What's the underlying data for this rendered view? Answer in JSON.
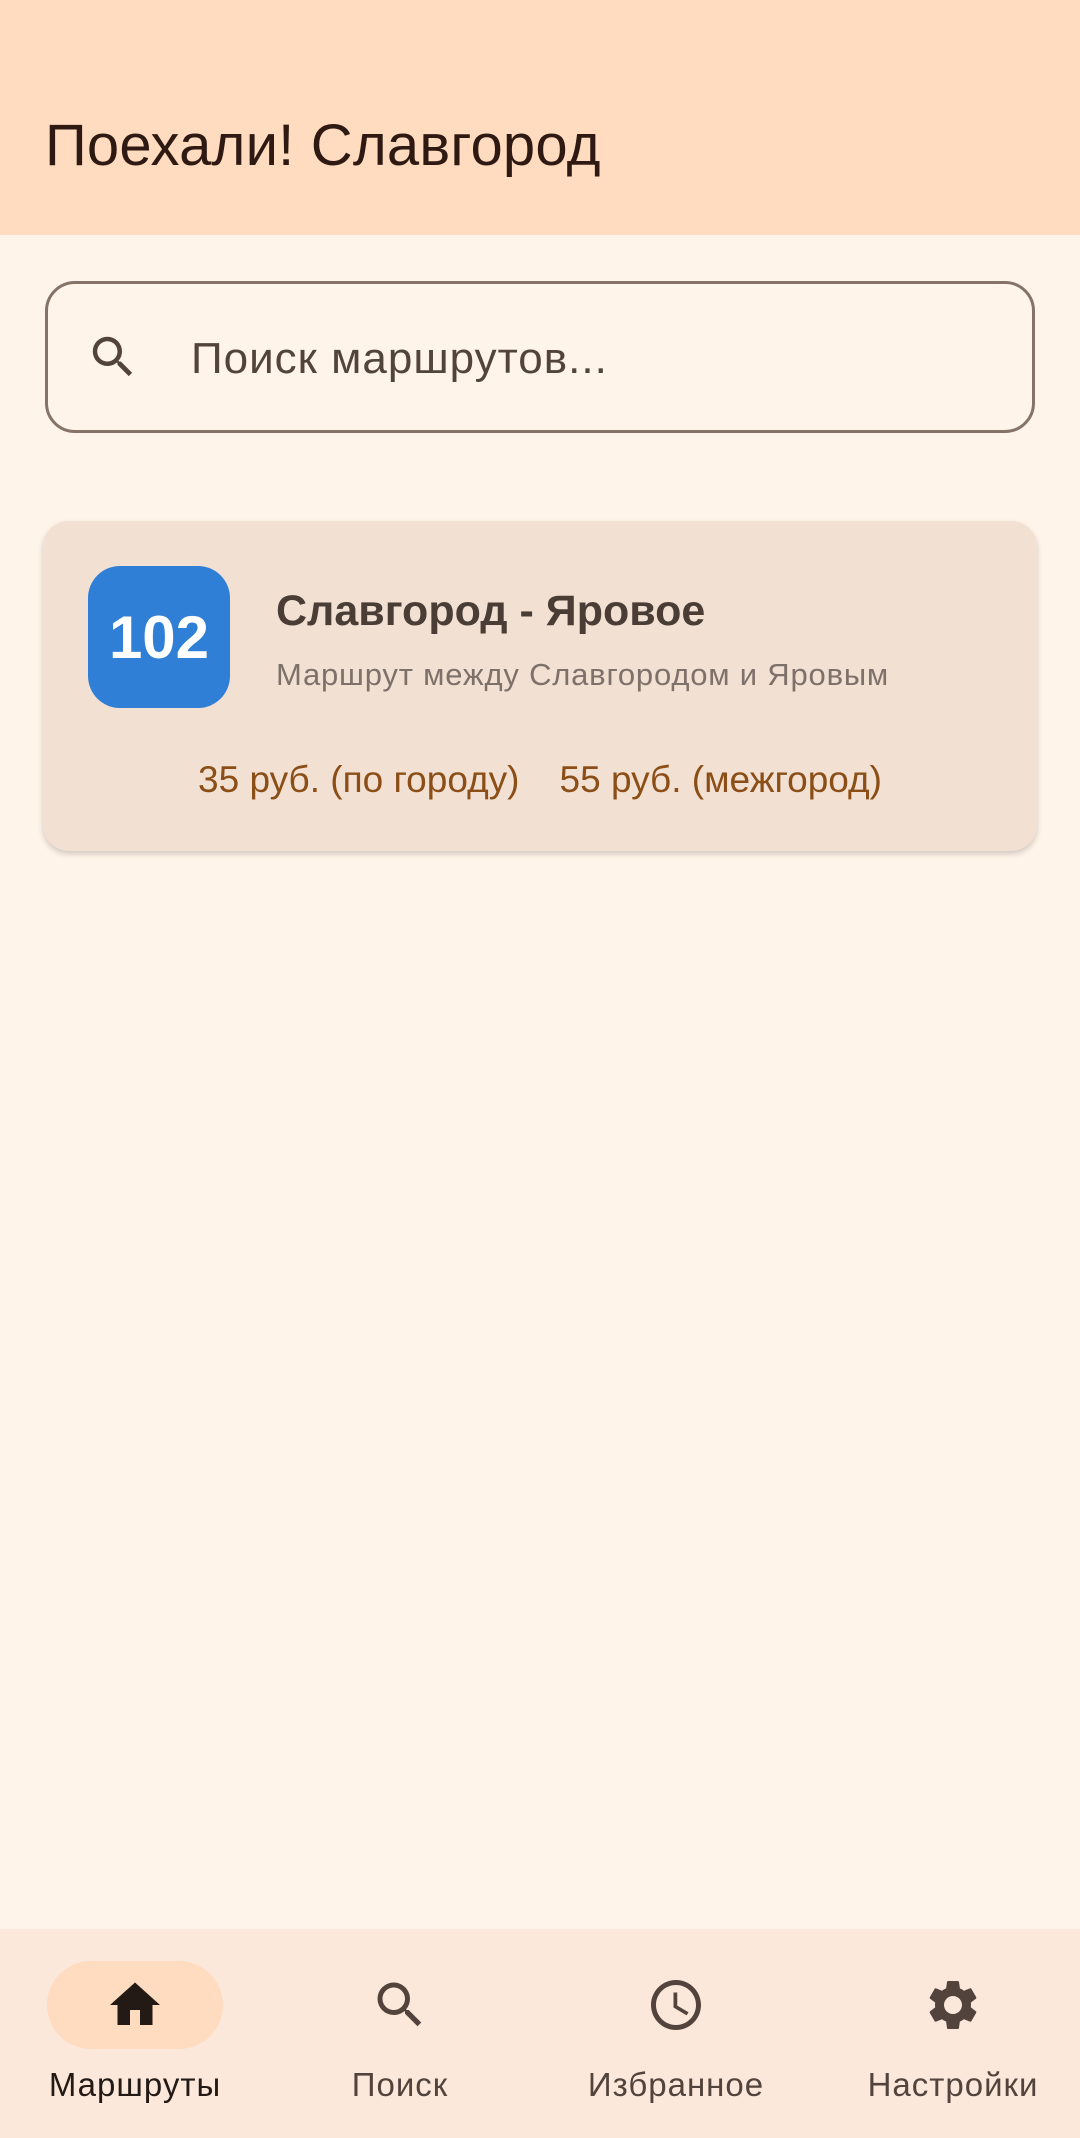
{
  "app": {
    "title": "Поехали! Славгород"
  },
  "search": {
    "placeholder": "Поиск маршрутов...",
    "icon": "search-icon"
  },
  "routes": [
    {
      "number": "102",
      "badge_color": "#2F7FD6",
      "name": "Славгород - Яровое",
      "description": "Маршрут между Славгородом и Яровым",
      "fare_city": "35 руб. (по городу)",
      "fare_intercity": "55 руб. (межгород)"
    }
  ],
  "bottom_nav": {
    "items": [
      {
        "label": "Маршруты",
        "icon": "home-icon",
        "active": true
      },
      {
        "label": "Поиск",
        "icon": "search-icon",
        "active": false
      },
      {
        "label": "Избранное",
        "icon": "clock-icon",
        "active": false
      },
      {
        "label": "Настройки",
        "icon": "gear-icon",
        "active": false
      }
    ]
  },
  "colors": {
    "top_bar": "#FFDBBF",
    "background": "#FFF4E9",
    "card": "#F2E0D3",
    "fare_text": "#8B4E16",
    "nav_bar": "#FBE8DB",
    "nav_active_indicator": "#FFDBBF"
  }
}
